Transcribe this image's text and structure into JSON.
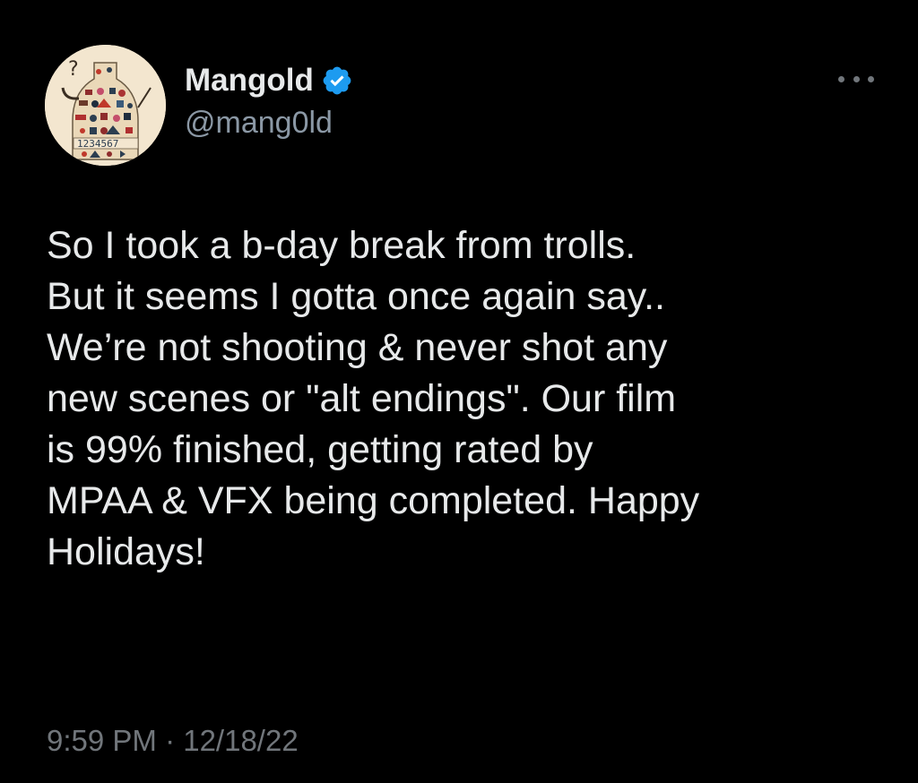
{
  "user": {
    "display_name": "Mangold",
    "handle": "@mang0ld",
    "verified": true,
    "avatar_digits": "1234567"
  },
  "tweet": {
    "text": "So I took a b-day break from trolls.\nBut it seems I gotta once again say..\nWe’re not shooting & never shot any\nnew scenes or \"alt endings\". Our film\nis 99% finished, getting rated by\nMPAA & VFX being completed. Happy\nHolidays!",
    "timestamp": "9:59 PM · 12/18/22"
  },
  "icons": {
    "verified": "verified-badge-icon",
    "more": "more-options-icon"
  },
  "colors": {
    "background": "#000000",
    "primary_text": "#e7e9ea",
    "secondary_text": "#71767b",
    "verified_blue": "#1d9bf0"
  }
}
